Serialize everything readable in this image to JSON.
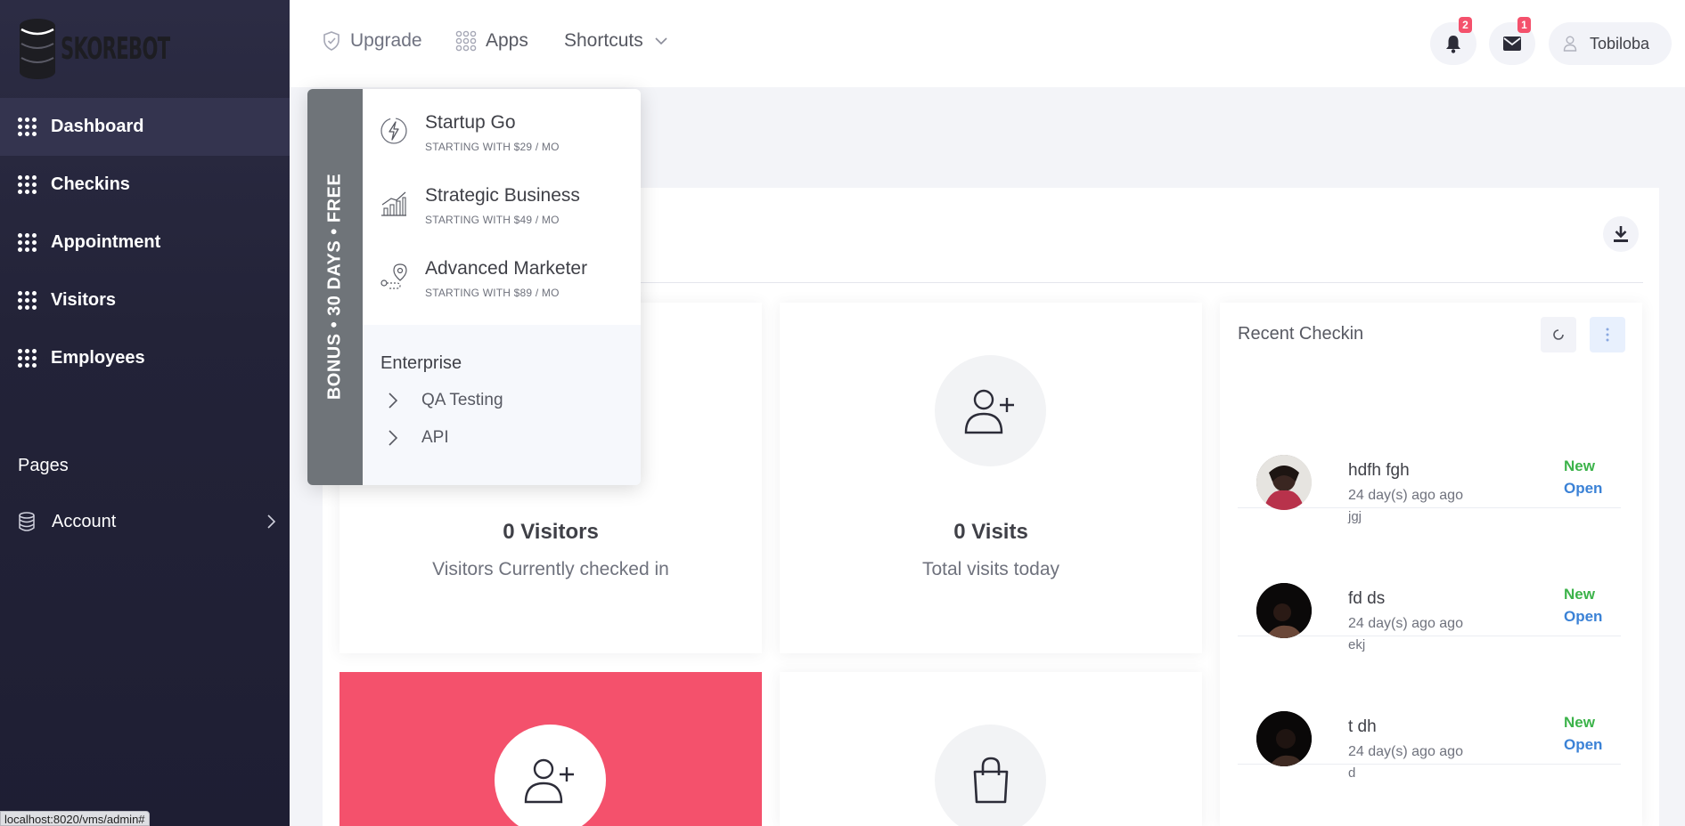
{
  "app": {
    "logo_text": "SKOREBOT"
  },
  "sidebar": {
    "items": [
      {
        "label": "Dashboard",
        "active": true
      },
      {
        "label": "Checkins"
      },
      {
        "label": "Appointment"
      },
      {
        "label": "Visitors"
      },
      {
        "label": "Employees"
      }
    ],
    "section_title": "Pages",
    "account_label": "Account"
  },
  "status_url": "localhost:8020/vms/admin#",
  "topbar": {
    "upgrade_label": "Upgrade",
    "apps_label": "Apps",
    "shortcuts_label": "Shortcuts",
    "notifications_count": "2",
    "messages_count": "1",
    "user_name": "Tobiloba"
  },
  "dropdown": {
    "bonus_text": "BONUS • 30 DAYS • FREE",
    "plans": [
      {
        "title": "Startup Go",
        "subtitle": "STARTING WITH $29 / MO",
        "icon": "lightning-icon"
      },
      {
        "title": "Strategic Business",
        "subtitle": "STARTING WITH $49 / MO",
        "icon": "bar-chart-icon"
      },
      {
        "title": "Advanced Marketer",
        "subtitle": "STARTING WITH $89 / MO",
        "icon": "map-route-icon"
      }
    ],
    "enterprise_title": "Enterprise",
    "enterprise_items": [
      "QA Testing",
      "API"
    ]
  },
  "stats": {
    "visitors_value": "0 Visitors",
    "visitors_sub": "Visitors Currently checked in",
    "visits_value": "0 Visits",
    "visits_sub": "Total visits today"
  },
  "recent_checkin": {
    "title": "Recent Checkin",
    "items": [
      {
        "name": "hdfh fgh",
        "time": "24 day(s) ago ago",
        "note": "jgj",
        "status": "New",
        "action": "Open"
      },
      {
        "name": "fd ds",
        "time": "24 day(s) ago ago",
        "note": "ekj",
        "status": "New",
        "action": "Open"
      },
      {
        "name": "t dh",
        "time": "24 day(s) ago ago",
        "note": "d",
        "status": "New",
        "action": "Open"
      }
    ]
  },
  "colors": {
    "sidebar_bg": "#232338",
    "accent_red": "#f4516c",
    "status_new": "#3cb34a",
    "link_blue": "#3b82d6",
    "bonus_gray": "#6f7479"
  }
}
